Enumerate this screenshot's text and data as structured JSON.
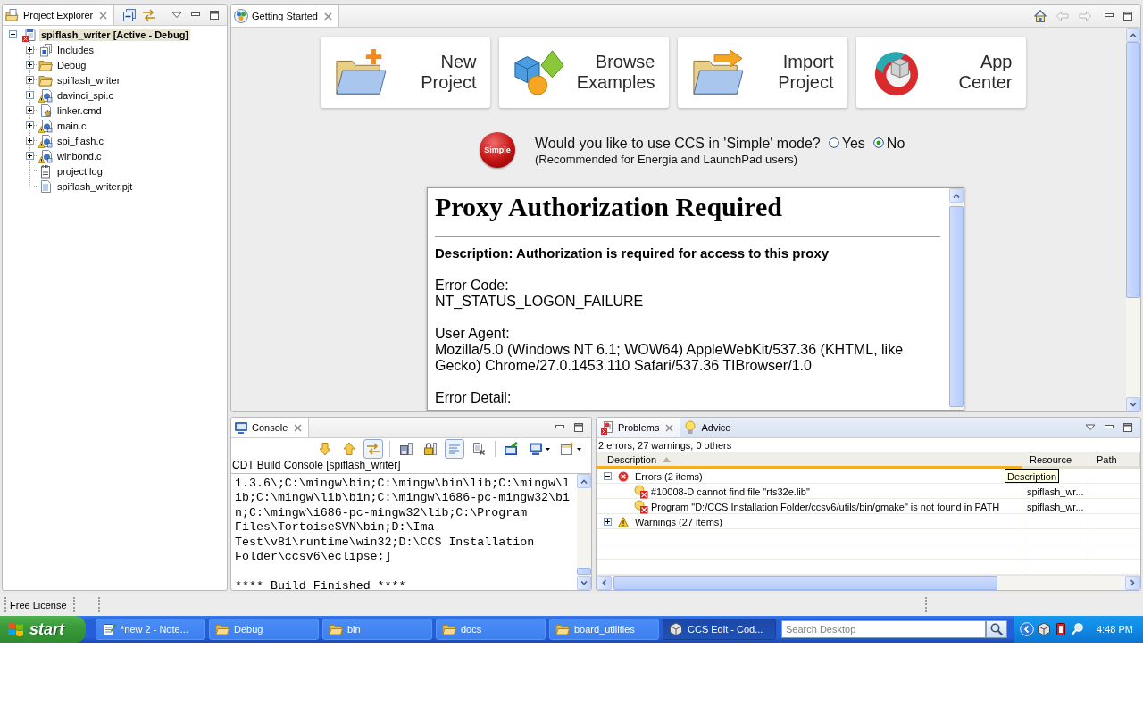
{
  "project_explorer": {
    "tab": {
      "label": "Project Explorer",
      "selected": true
    },
    "tree": {
      "label": "spiflash_writer [Active - Debug]",
      "kind": "project",
      "expanded": true,
      "selected": true,
      "warning": false,
      "error": true,
      "children": [
        {
          "label": "Includes",
          "kind": "includes",
          "expanded": false,
          "selected": false,
          "warning": false,
          "error": false
        },
        {
          "label": "Debug",
          "kind": "folder",
          "expanded": false,
          "selected": false,
          "warning": false,
          "error": false
        },
        {
          "label": "spiflash_writer",
          "kind": "folder",
          "expanded": false,
          "selected": false,
          "warning": false,
          "error": false
        },
        {
          "label": "davinci_spi.c",
          "kind": "c_file",
          "expanded": false,
          "selected": false,
          "warning": true,
          "error": false
        },
        {
          "label": "linker.cmd",
          "kind": "cmd_file",
          "expanded": false,
          "selected": false,
          "warning": false,
          "error": false
        },
        {
          "label": "main.c",
          "kind": "c_file",
          "expanded": false,
          "selected": false,
          "warning": true,
          "error": false
        },
        {
          "label": "spi_flash.c",
          "kind": "c_file",
          "expanded": false,
          "selected": false,
          "warning": true,
          "error": false
        },
        {
          "label": "winbond.c",
          "kind": "c_file",
          "expanded": false,
          "selected": false,
          "warning": true,
          "error": false
        },
        {
          "label": "project.log",
          "kind": "log_file",
          "selected": false,
          "warning": false,
          "error": false
        },
        {
          "label": "spiflash_writer.pjt",
          "kind": "text_file",
          "selected": false,
          "warning": false,
          "error": false
        }
      ]
    }
  },
  "editor": {
    "tab": {
      "label": "Getting Started",
      "selected": true
    },
    "nav": [
      {
        "kind": "home",
        "disabled": false
      },
      {
        "kind": "back",
        "disabled": true
      },
      {
        "kind": "forward",
        "disabled": true
      }
    ],
    "actions": [
      {
        "kind": "new_project",
        "label": "New Project"
      },
      {
        "kind": "browse_examples",
        "label": "Browse Examples"
      },
      {
        "kind": "import_project",
        "label": "Import Project"
      },
      {
        "kind": "app_center",
        "label": "App Center"
      }
    ],
    "simple_mode": {
      "badge": "Simple",
      "question": "Would you like to use CCS in 'Simple' mode?",
      "options": [
        {
          "label": "Yes",
          "selected": false
        },
        {
          "label": "No",
          "selected": true
        }
      ],
      "note": "(Recommended for Energia and LaunchPad users)"
    },
    "web_view": {
      "heading": "Proxy Authorization Required",
      "description": "Description: Authorization is required for access to this proxy",
      "sections": [
        {
          "title": "Error Code:",
          "text": "NT_STATUS_LOGON_FAILURE"
        },
        {
          "title": "User Agent:",
          "text": "Mozilla/5.0 (Windows NT 6.1; WOW64) AppleWebKit/537.36 (KHTML, like Gecko) Chrome/27.0.1453.110 Safari/537.36 TIBrowser/1.0"
        },
        {
          "title": "Error Detail:"
        }
      ]
    }
  },
  "console": {
    "tab": {
      "label": "Console",
      "selected": true
    },
    "toolbar": [
      [
        {
          "kind": "arrow_down",
          "pressed": false,
          "menu": false
        },
        {
          "kind": "arrow_up",
          "pressed": false,
          "menu": false
        },
        {
          "kind": "swap_arrows",
          "pressed": true,
          "menu": false
        }
      ],
      [
        {
          "kind": "save_log",
          "pressed": false,
          "menu": false
        },
        {
          "kind": "lock",
          "pressed": false,
          "menu": false
        },
        {
          "kind": "wrap_lines",
          "pressed": true,
          "menu": false
        },
        {
          "kind": "clear",
          "pressed": false,
          "menu": false
        }
      ],
      [
        {
          "kind": "pin",
          "pressed": false,
          "menu": false
        },
        {
          "kind": "display",
          "pressed": false,
          "menu": true
        },
        {
          "kind": "new_console",
          "pressed": false,
          "menu": true
        }
      ]
    ],
    "title": "CDT Build Console [spiflash_writer]",
    "output": [
      "1.3.6\\;C:\\mingw\\bin;C:\\mingw\\bin\\lib;C:\\mingw\\l",
      "ib;C:\\mingw\\lib\\bin;C:\\mingw\\i686-pc-mingw32\\bi",
      "n;C:\\mingw\\i686-pc-mingw32\\lib;C:\\Program",
      "Files\\TortoiseSVN\\bin;D:\\Ima",
      "Test\\v81\\runtime\\win32;D:\\CCS Installation",
      "Folder\\ccsv6\\eclipse;]"
    ],
    "footer": "**** Build Finished ****"
  },
  "problems": {
    "tabs": [
      {
        "kind": "problems",
        "label": "Problems",
        "selected": true
      },
      {
        "kind": "advice",
        "label": "Advice",
        "selected": false
      }
    ],
    "summary": "2 errors, 27 warnings, 0 others",
    "columns": [
      {
        "label": "Description",
        "sorted": true
      },
      {
        "label": "Resource",
        "sorted": false
      },
      {
        "label": "Path",
        "sorted": false
      }
    ],
    "groups": [
      {
        "kind": "error",
        "label": "Errors (2 items)",
        "expanded": true,
        "items": [
          {
            "description": "#10008-D cannot find file \"rts32e.lib\"",
            "resource": "spiflash_wr..."
          },
          {
            "description": "Program \"D:/CCS Installation Folder/ccsv6/utils/bin/gmake\" is not found in PATH",
            "resource": "spiflash_wr..."
          }
        ]
      },
      {
        "kind": "warning",
        "label": "Warnings (27 items)",
        "expanded": false
      }
    ],
    "tooltip": "Description"
  },
  "status_bar": {
    "license": "Free License"
  },
  "taskbar": {
    "start": "start",
    "tasks": [
      {
        "kind": "notepad",
        "label": "*new 2 - Note...",
        "selected": false
      },
      {
        "kind": "folder",
        "label": "Debug",
        "selected": false
      },
      {
        "kind": "folder",
        "label": "bin",
        "selected": false
      },
      {
        "kind": "folder",
        "label": "docs",
        "selected": false
      },
      {
        "kind": "folder",
        "label": "board_utilities",
        "selected": false
      },
      {
        "kind": "ccs",
        "label": "CCS Edit - Cod...",
        "selected": true
      }
    ],
    "search": {
      "placeholder": "Search Desktop"
    },
    "clock": "4:48 PM"
  }
}
